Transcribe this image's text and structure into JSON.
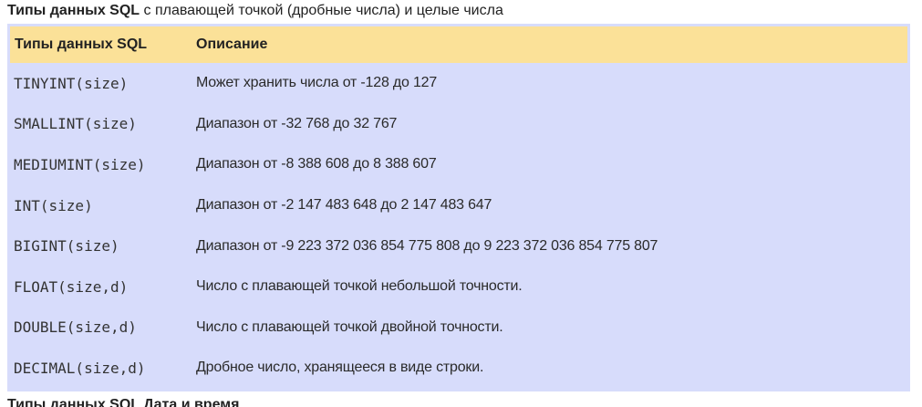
{
  "caption": {
    "bold": "Типы данных SQL",
    "rest": " с плавающей точкой (дробные числа) и целые числа"
  },
  "table": {
    "headers": [
      "Типы данных SQL",
      "Описание"
    ],
    "rows": [
      {
        "type": "TINYINT(size)",
        "desc": "Может хранить числа от -128 до 127"
      },
      {
        "type": "SMALLINT(size)",
        "desc": "Диапазон от -32 768 до 32 767"
      },
      {
        "type": "MEDIUMINT(size)",
        "desc": "Диапазон от -8 388 608 до 8 388 607"
      },
      {
        "type": "INT(size)",
        "desc": "Диапазон от -2 147 483 648 до 2 147 483 647"
      },
      {
        "type": "BIGINT(size)",
        "desc": "Диапазон от -9 223 372 036 854 775 808 до 9 223 372 036 854 775 807"
      },
      {
        "type": "FLOAT(size,d)",
        "desc": "Число с плавающей точкой небольшой точности."
      },
      {
        "type": "DOUBLE(size,d)",
        "desc": "Число с плавающей точкой двойной точности."
      },
      {
        "type": "DECIMAL(size,d)",
        "desc": "Дробное число, хранящееся в виде строки."
      }
    ]
  },
  "next_caption": "Типы данных SQL  Дата и время"
}
